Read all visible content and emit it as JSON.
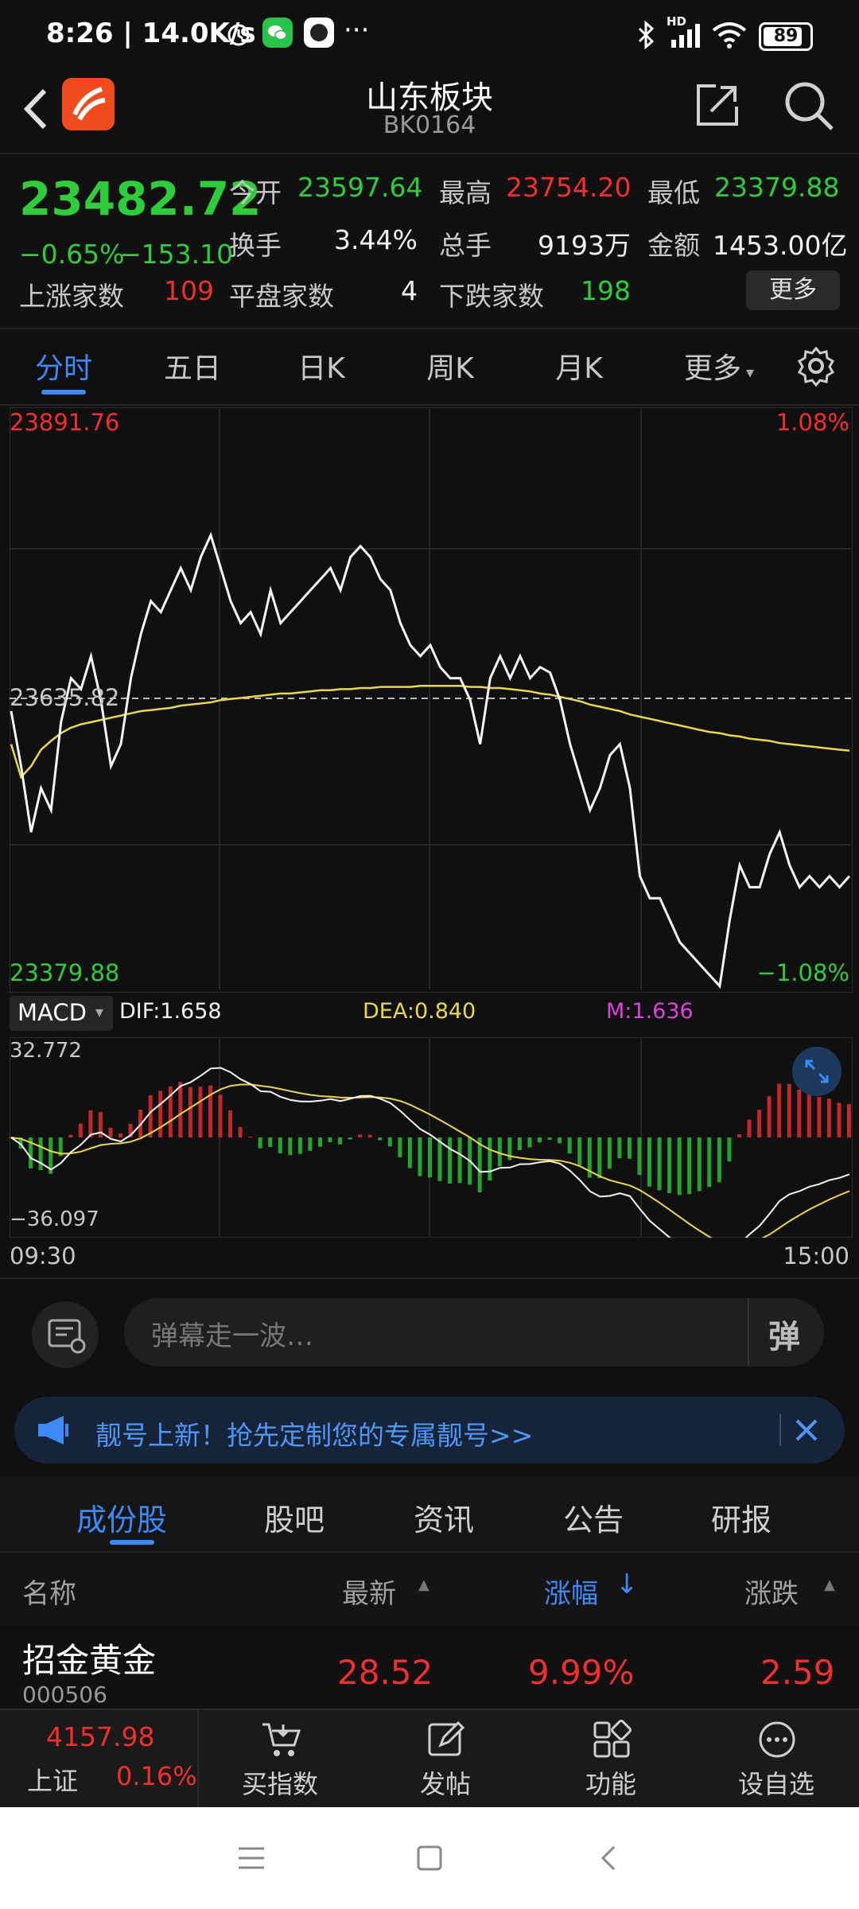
{
  "status": {
    "time": "8:26 | 14.0K/s",
    "more": "···",
    "battery": "89",
    "net_badge": "HD"
  },
  "header": {
    "title": "山东板块",
    "code": "BK0164",
    "back_icon": "chevron-left-icon",
    "share_icon": "share-icon",
    "search_icon": "search-icon"
  },
  "quote": {
    "price": "23482.72",
    "change_pct": "−0.65%",
    "change_val": "−153.10",
    "open_label": "今开",
    "open": "23597.64",
    "high_label": "最高",
    "high": "23754.20",
    "low_label": "最低",
    "low": "23379.88",
    "turnover_label": "换手",
    "turnover": "3.44%",
    "volume_label": "总手",
    "volume": "9193万",
    "amount_label": "金额",
    "amount": "1453.00亿",
    "up_label": "上涨家数",
    "up": "109",
    "flat_label": "平盘家数",
    "flat": "4",
    "down_label": "下跌家数",
    "down": "198",
    "more_btn": "更多"
  },
  "chart_tabs": [
    "分时",
    "五日",
    "日K",
    "周K",
    "月K",
    "更多"
  ],
  "chart": {
    "top_price": "23891.76",
    "top_pct": "1.08%",
    "mid_price": "23635.82",
    "bottom_price": "23379.88",
    "bottom_pct": "−1.08%",
    "time_start": "09:30",
    "time_end": "15:00"
  },
  "macd": {
    "selector": "MACD",
    "dif": "DIF:1.658",
    "dea": "DEA:0.840",
    "m": "M:1.636",
    "max": "32.772",
    "min": "−36.097"
  },
  "chart_data": {
    "type": "line",
    "ylim": [
      23379.88,
      23891.76
    ],
    "baseline": 23635.82,
    "series": [
      {
        "values": [
          23630,
          23580,
          23520,
          23560,
          23540,
          23620,
          23660,
          23650,
          23680,
          23640,
          23580,
          23600,
          23660,
          23700,
          23730,
          23720,
          23740,
          23760,
          23740,
          23770,
          23790,
          23760,
          23730,
          23710,
          23720,
          23700,
          23740,
          23710,
          23720,
          23730,
          23740,
          23750,
          23760,
          23740,
          23770,
          23780,
          23770,
          23750,
          23740,
          23710,
          23690,
          23680,
          23690,
          23670,
          23660,
          23660,
          23640,
          23600,
          23660,
          23680,
          23660,
          23680,
          23660,
          23670,
          23665,
          23640,
          23600,
          23570,
          23540,
          23560,
          23590,
          23600,
          23560,
          23480,
          23460,
          23460,
          23440,
          23420,
          23410,
          23400,
          23390,
          23380,
          23440,
          23490,
          23470,
          23470,
          23500,
          23520,
          23490,
          23470,
          23480,
          23470,
          23480,
          23470,
          23480
        ]
      },
      {
        "values": [
          23600,
          23570,
          23580,
          23595,
          23603,
          23610,
          23615,
          23618,
          23620,
          23622,
          23624,
          23626,
          23628,
          23630,
          23631,
          23632,
          23633,
          23635,
          23636,
          23637,
          23638,
          23640,
          23641,
          23642,
          23643,
          23644,
          23645,
          23646,
          23646,
          23647,
          23648,
          23649,
          23649,
          23650,
          23650,
          23651,
          23651,
          23652,
          23652,
          23652,
          23652,
          23653,
          23653,
          23653,
          23653,
          23653,
          23652,
          23652,
          23651,
          23651,
          23650,
          23649,
          23648,
          23646,
          23645,
          23643,
          23641,
          23639,
          23636,
          23634,
          23632,
          23630,
          23627,
          23625,
          23623,
          23621,
          23619,
          23617,
          23615,
          23613,
          23611,
          23610,
          23608,
          23607,
          23605,
          23604,
          23603,
          23601,
          23600,
          23599,
          23598,
          23597,
          23596,
          23595,
          23594
        ]
      }
    ]
  },
  "danmu": {
    "placeholder": "弹幕走一波…",
    "toggle": "弹"
  },
  "banner": {
    "text": "靓号上新！抢先定制您的专属靓号>>"
  },
  "sections": [
    "成份股",
    "股吧",
    "资讯",
    "公告",
    "研报"
  ],
  "table": {
    "headers": [
      "名称",
      "最新",
      "涨幅",
      "涨跌"
    ],
    "rows": [
      {
        "name": "招金黄金",
        "code": "000506",
        "price": "28.52",
        "pct": "9.99%",
        "chg": "2.59"
      }
    ]
  },
  "bottom_nav": {
    "index_val": "4157.98",
    "index_name": "上证",
    "index_pct": "0.16%",
    "items": [
      "买指数",
      "发帖",
      "功能",
      "设自选"
    ]
  },
  "colors": {
    "up": "#f0302f",
    "down": "#2fcc3c",
    "accent": "#3d8af7",
    "avg_line": "#e8d84a"
  }
}
